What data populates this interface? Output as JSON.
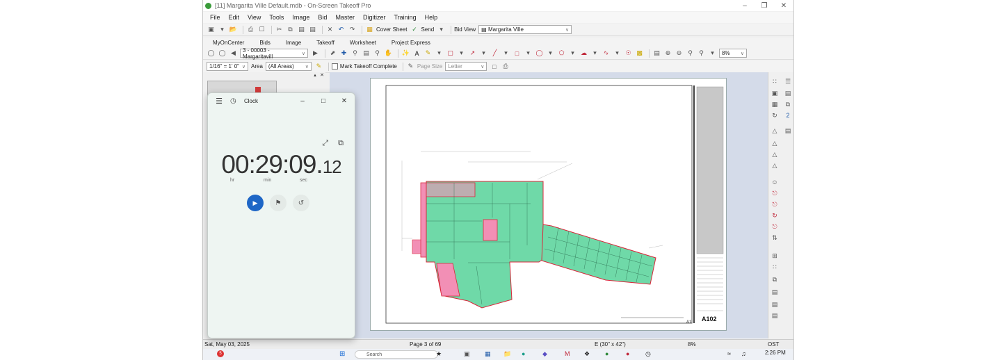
{
  "window": {
    "title": "[11] Margarita Ville Default.mdb - On-Screen Takeoff Pro",
    "min_icon": "minimize-icon",
    "restore_icon": "restore-icon",
    "close_icon": "close-icon"
  },
  "menu": [
    "File",
    "Edit",
    "View",
    "Tools",
    "Image",
    "Bid",
    "Master",
    "Digitizer",
    "Training",
    "Help"
  ],
  "toolbar1": {
    "cover_sheet": "Cover Sheet",
    "send": "Send",
    "bid_view_label": "Bid View",
    "bid_view_value": "Margarita Ville"
  },
  "tabs": [
    "MyOnCenter",
    "Bids",
    "Image",
    "Takeoff",
    "Worksheet",
    "Project Express"
  ],
  "toolbar3": {
    "page_select": "3 - 00003 - Margaritavill",
    "zoom": "8%"
  },
  "toolbar4": {
    "scale": "1/16\" = 1' 0\"",
    "area_label": "Area",
    "area_value": "(All Areas)",
    "mark_complete": "Mark Takeoff Complete",
    "page_size_label": "Page Size",
    "page_size_value": "Letter"
  },
  "sheet": {
    "sheet_number": "A102",
    "corner_label": "A1"
  },
  "status": {
    "date": "Sat, May 03, 2025",
    "page": "Page 3 of 69",
    "paper": "E (30\" x 42\")",
    "zoom": "8%",
    "mode": "OST"
  },
  "taskbar": {
    "badge": "5",
    "search": "Search",
    "time": "2:26 PM"
  },
  "clock": {
    "title": "Clock",
    "time_main": "00:29:09.",
    "time_ms": "12",
    "unit_hr": "hr",
    "unit_min": "min",
    "unit_sec": "sec"
  },
  "colors": {
    "takeoff_fill": "#6fd9a8",
    "takeoff_outline": "#d9263a",
    "pink_area": "#f28fb5",
    "play_button": "#1e66c6"
  }
}
